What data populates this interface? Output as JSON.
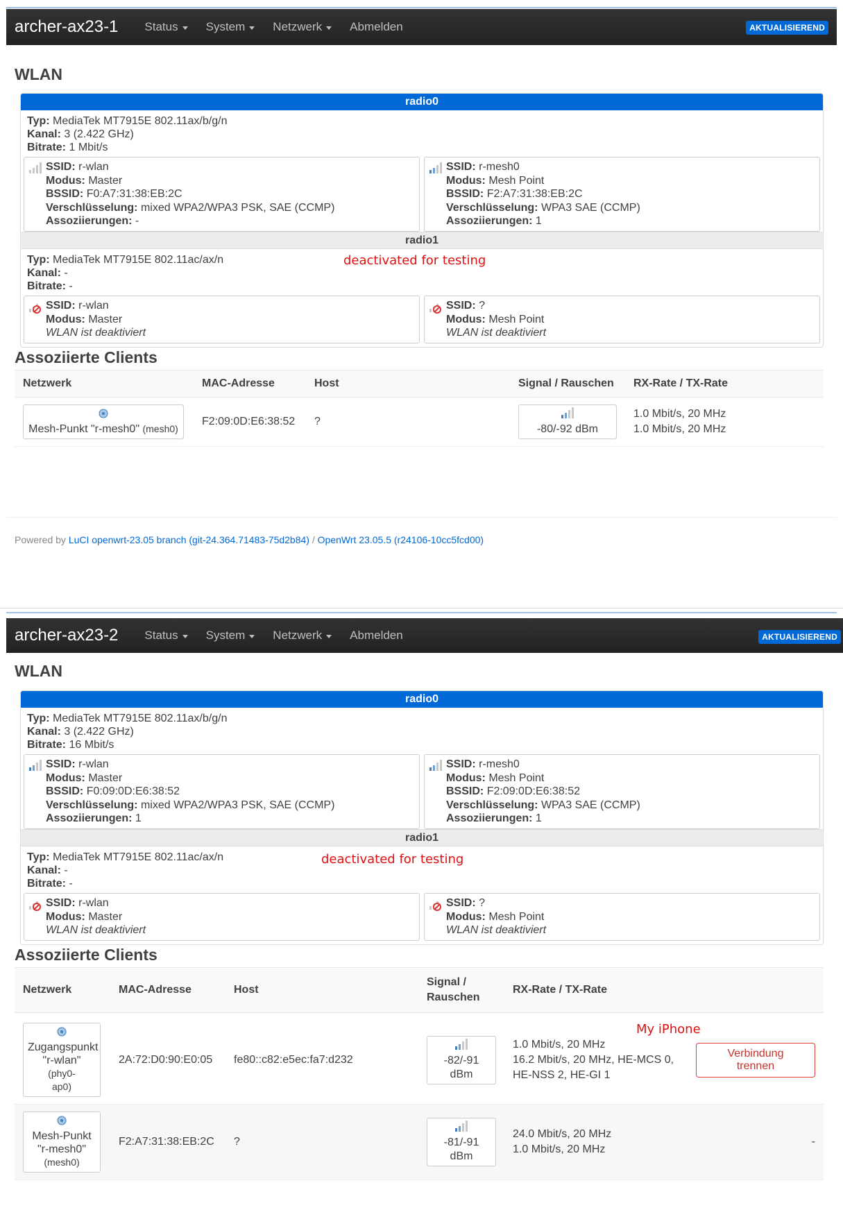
{
  "panels": [
    {
      "brand": "archer-ax23-1",
      "nav": [
        "Status",
        "System",
        "Netzwerk",
        "Abmelden"
      ],
      "badge": "AKTUALISIEREND",
      "wlan_title": "WLAN",
      "radio0": {
        "name": "radio0",
        "typ_label": "Typ:",
        "typ": "MediaTek MT7915E 802.11ax/b/g/n",
        "kanal_label": "Kanal:",
        "kanal": "3 (2.422 GHz)",
        "bitrate_label": "Bitrate:",
        "bitrate": "1 Mbit/s",
        "left": {
          "ssid": "r-wlan",
          "modus": "Master",
          "bssid": "F0:A7:31:38:EB:2C",
          "enc": "mixed WPA2/WPA3 PSK, SAE (CCMP)",
          "assoc": "-"
        },
        "right": {
          "ssid": "r-mesh0",
          "modus": "Mesh Point",
          "bssid": "F2:A7:31:38:EB:2C",
          "enc": "WPA3 SAE (CCMP)",
          "assoc": "1"
        }
      },
      "radio1": {
        "name": "radio1",
        "typ": "MediaTek MT7915E 802.11ac/ax/n",
        "kanal": "-",
        "bitrate": "-",
        "annotation": "deactivated for testing",
        "left": {
          "ssid": "r-wlan",
          "modus": "Master",
          "disabled": "WLAN ist deaktiviert"
        },
        "right": {
          "ssid": "?",
          "modus": "Mesh Point",
          "disabled": "WLAN ist deaktiviert"
        }
      },
      "clients_title": "Assoziierte Clients",
      "clients_headers": [
        "Netzwerk",
        "MAC-Adresse",
        "Host",
        "Signal / Rauschen",
        "RX-Rate / TX-Rate"
      ],
      "clients": [
        {
          "net_main": "Mesh-Punkt \"r-mesh0\"",
          "net_sub": "(mesh0)",
          "mac": "F2:09:0D:E6:38:52",
          "host": "?",
          "signal": "-80/-92 dBm",
          "rx": "1.0 Mbit/s, 20 MHz",
          "tx": "1.0 Mbit/s, 20 MHz"
        }
      ],
      "footer": {
        "prefix": "Powered by ",
        "luci": "LuCI openwrt-23.05 branch (git-24.364.71483-75d2b84)",
        "sep": " / ",
        "openwrt": "OpenWrt 23.05.5 (r24106-10cc5fcd00)"
      }
    },
    {
      "brand": "archer-ax23-2",
      "nav": [
        "Status",
        "System",
        "Netzwerk",
        "Abmelden"
      ],
      "badge": "AKTUALISIEREND",
      "wlan_title": "WLAN",
      "radio0": {
        "name": "radio0",
        "typ": "MediaTek MT7915E 802.11ax/b/g/n",
        "kanal": "3 (2.422 GHz)",
        "bitrate": "16 Mbit/s",
        "left": {
          "ssid": "r-wlan",
          "modus": "Master",
          "bssid": "F0:09:0D:E6:38:52",
          "enc": "mixed WPA2/WPA3 PSK, SAE (CCMP)",
          "assoc": "1"
        },
        "right": {
          "ssid": "r-mesh0",
          "modus": "Mesh Point",
          "bssid": "F2:09:0D:E6:38:52",
          "enc": "WPA3 SAE (CCMP)",
          "assoc": "1"
        }
      },
      "radio1": {
        "name": "radio1",
        "typ": "MediaTek MT7915E 802.11ac/ax/n",
        "kanal": "-",
        "bitrate": "-",
        "annotation": "deactivated for testing",
        "left": {
          "ssid": "r-wlan",
          "modus": "Master",
          "disabled": "WLAN ist deaktiviert"
        },
        "right": {
          "ssid": "?",
          "modus": "Mesh Point",
          "disabled": "WLAN ist deaktiviert"
        }
      },
      "clients_title": "Assoziierte Clients",
      "clients_headers": [
        "Netzwerk",
        "MAC-Adresse",
        "Host",
        "Signal / Rauschen",
        "RX-Rate / TX-Rate"
      ],
      "annotation_iphone": "My iPhone",
      "clients": [
        {
          "net_l1": "Zugangspunkt",
          "net_l2": "\"r-wlan\"",
          "net_l2b": "(phy0-",
          "net_l3": "ap0)",
          "mac": "2A:72:D0:90:E0:05",
          "host": "fe80::c82:e5ec:fa7:d232",
          "signal": "-82/-91 dBm",
          "rx": "1.0 Mbit/s, 20 MHz",
          "tx1": "16.2 Mbit/s, 20 MHz, HE-MCS 0,",
          "tx2": "HE-NSS 2, HE-GI 1",
          "action": "Verbindung trennen"
        },
        {
          "net_l1": "Mesh-Punkt",
          "net_l2": "\"r-mesh0\"",
          "net_l3": "(mesh0)",
          "mac": "F2:A7:31:38:EB:2C",
          "host": "?",
          "signal": "-81/-91 dBm",
          "rx": "24.0 Mbit/s, 20 MHz",
          "tx": "1.0 Mbit/s, 20 MHz",
          "action": "-"
        }
      ]
    }
  ],
  "labels": {
    "typ": "Typ:",
    "kanal": "Kanal:",
    "bitrate": "Bitrate:",
    "ssid": "SSID:",
    "modus": "Modus:",
    "bssid": "BSSID:",
    "enc": "Verschlüsselung:",
    "assoc": "Assoziierungen:"
  }
}
